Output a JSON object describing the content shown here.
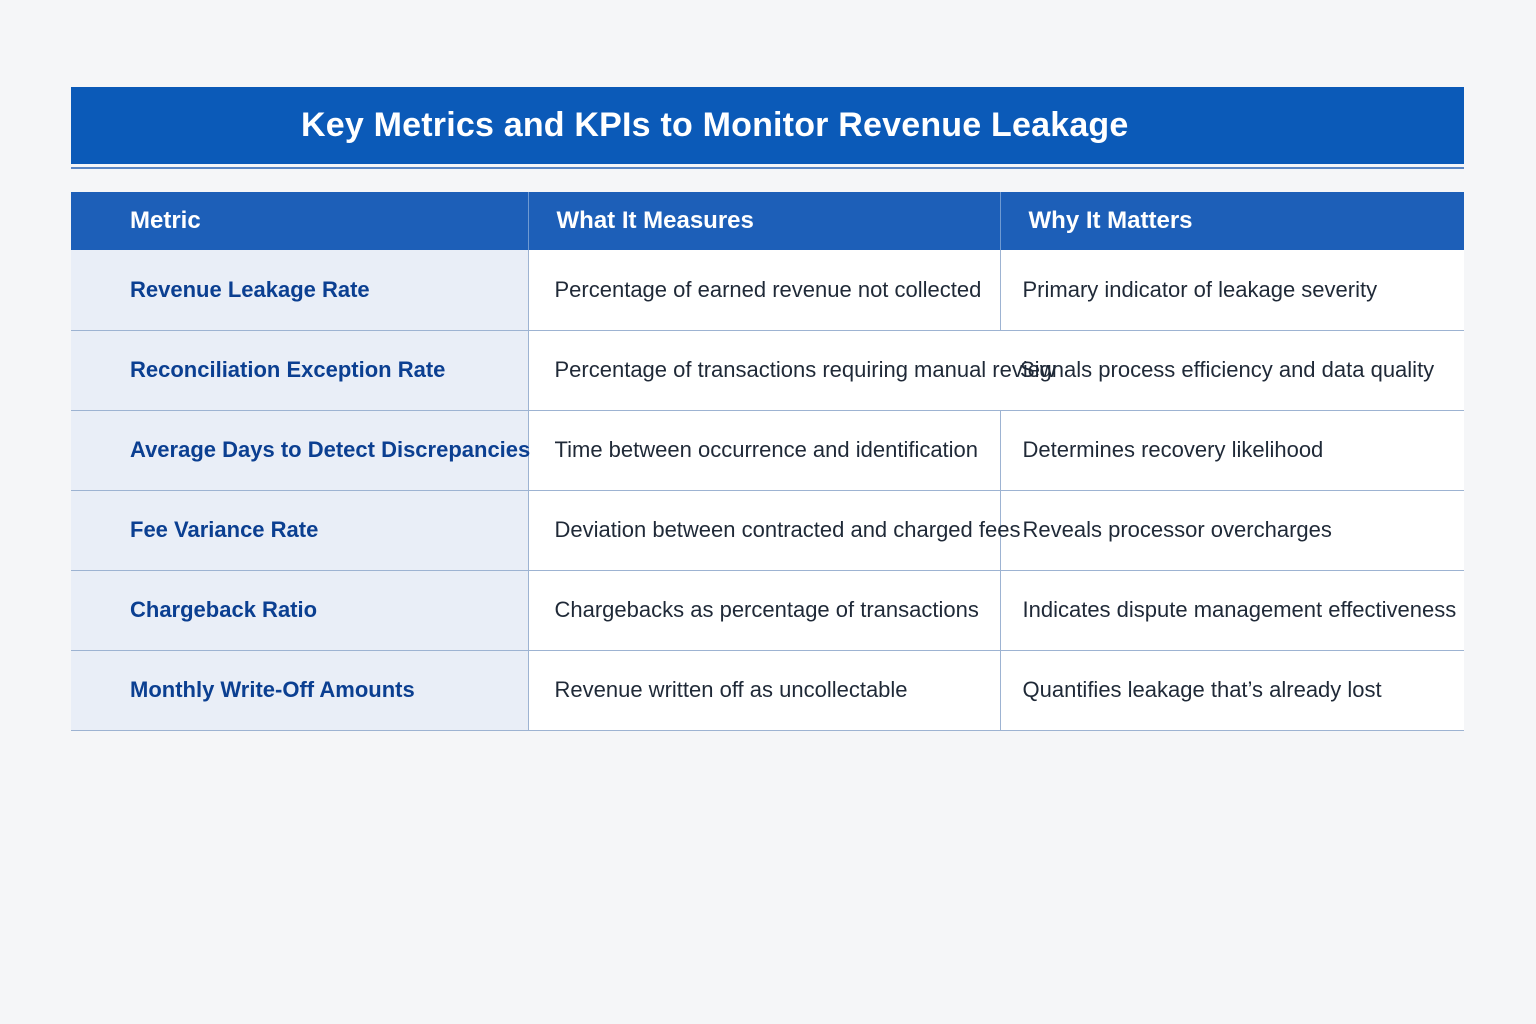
{
  "title": "Key Metrics and KPIs to Monitor Revenue Leakage",
  "table": {
    "headers": [
      "Metric",
      "What It Measures",
      "Why It Matters"
    ],
    "rows": [
      {
        "metric": "Revenue Leakage Rate",
        "measures": "Percentage of earned revenue not collected",
        "matters": "Primary indicator of leakage severity"
      },
      {
        "metric": "Reconciliation Exception Rate",
        "measures": "Percentage of transactions requiring manual review",
        "matters": "Signals process efficiency and data quality"
      },
      {
        "metric": "Average Days to Detect Discrepancies",
        "measures": "Time between occurrence and identification",
        "matters": "Determines recovery likelihood"
      },
      {
        "metric": "Fee Variance Rate",
        "measures": "Deviation between contracted and charged fees",
        "matters": "Reveals processor overcharges"
      },
      {
        "metric": "Chargeback Ratio",
        "measures": "Chargebacks as percentage of transactions",
        "matters": "Indicates dispute management effectiveness"
      },
      {
        "metric": "Monthly Write-Off Amounts",
        "measures": "Revenue written off as uncollectable",
        "matters": "Quantifies leakage that’s already lost"
      }
    ]
  },
  "colors": {
    "title_bg": "#0b5ab8",
    "header_bg": "#1d5fb8",
    "metric_text": "#0b3f91",
    "metric_bg": "#e9eef7"
  }
}
